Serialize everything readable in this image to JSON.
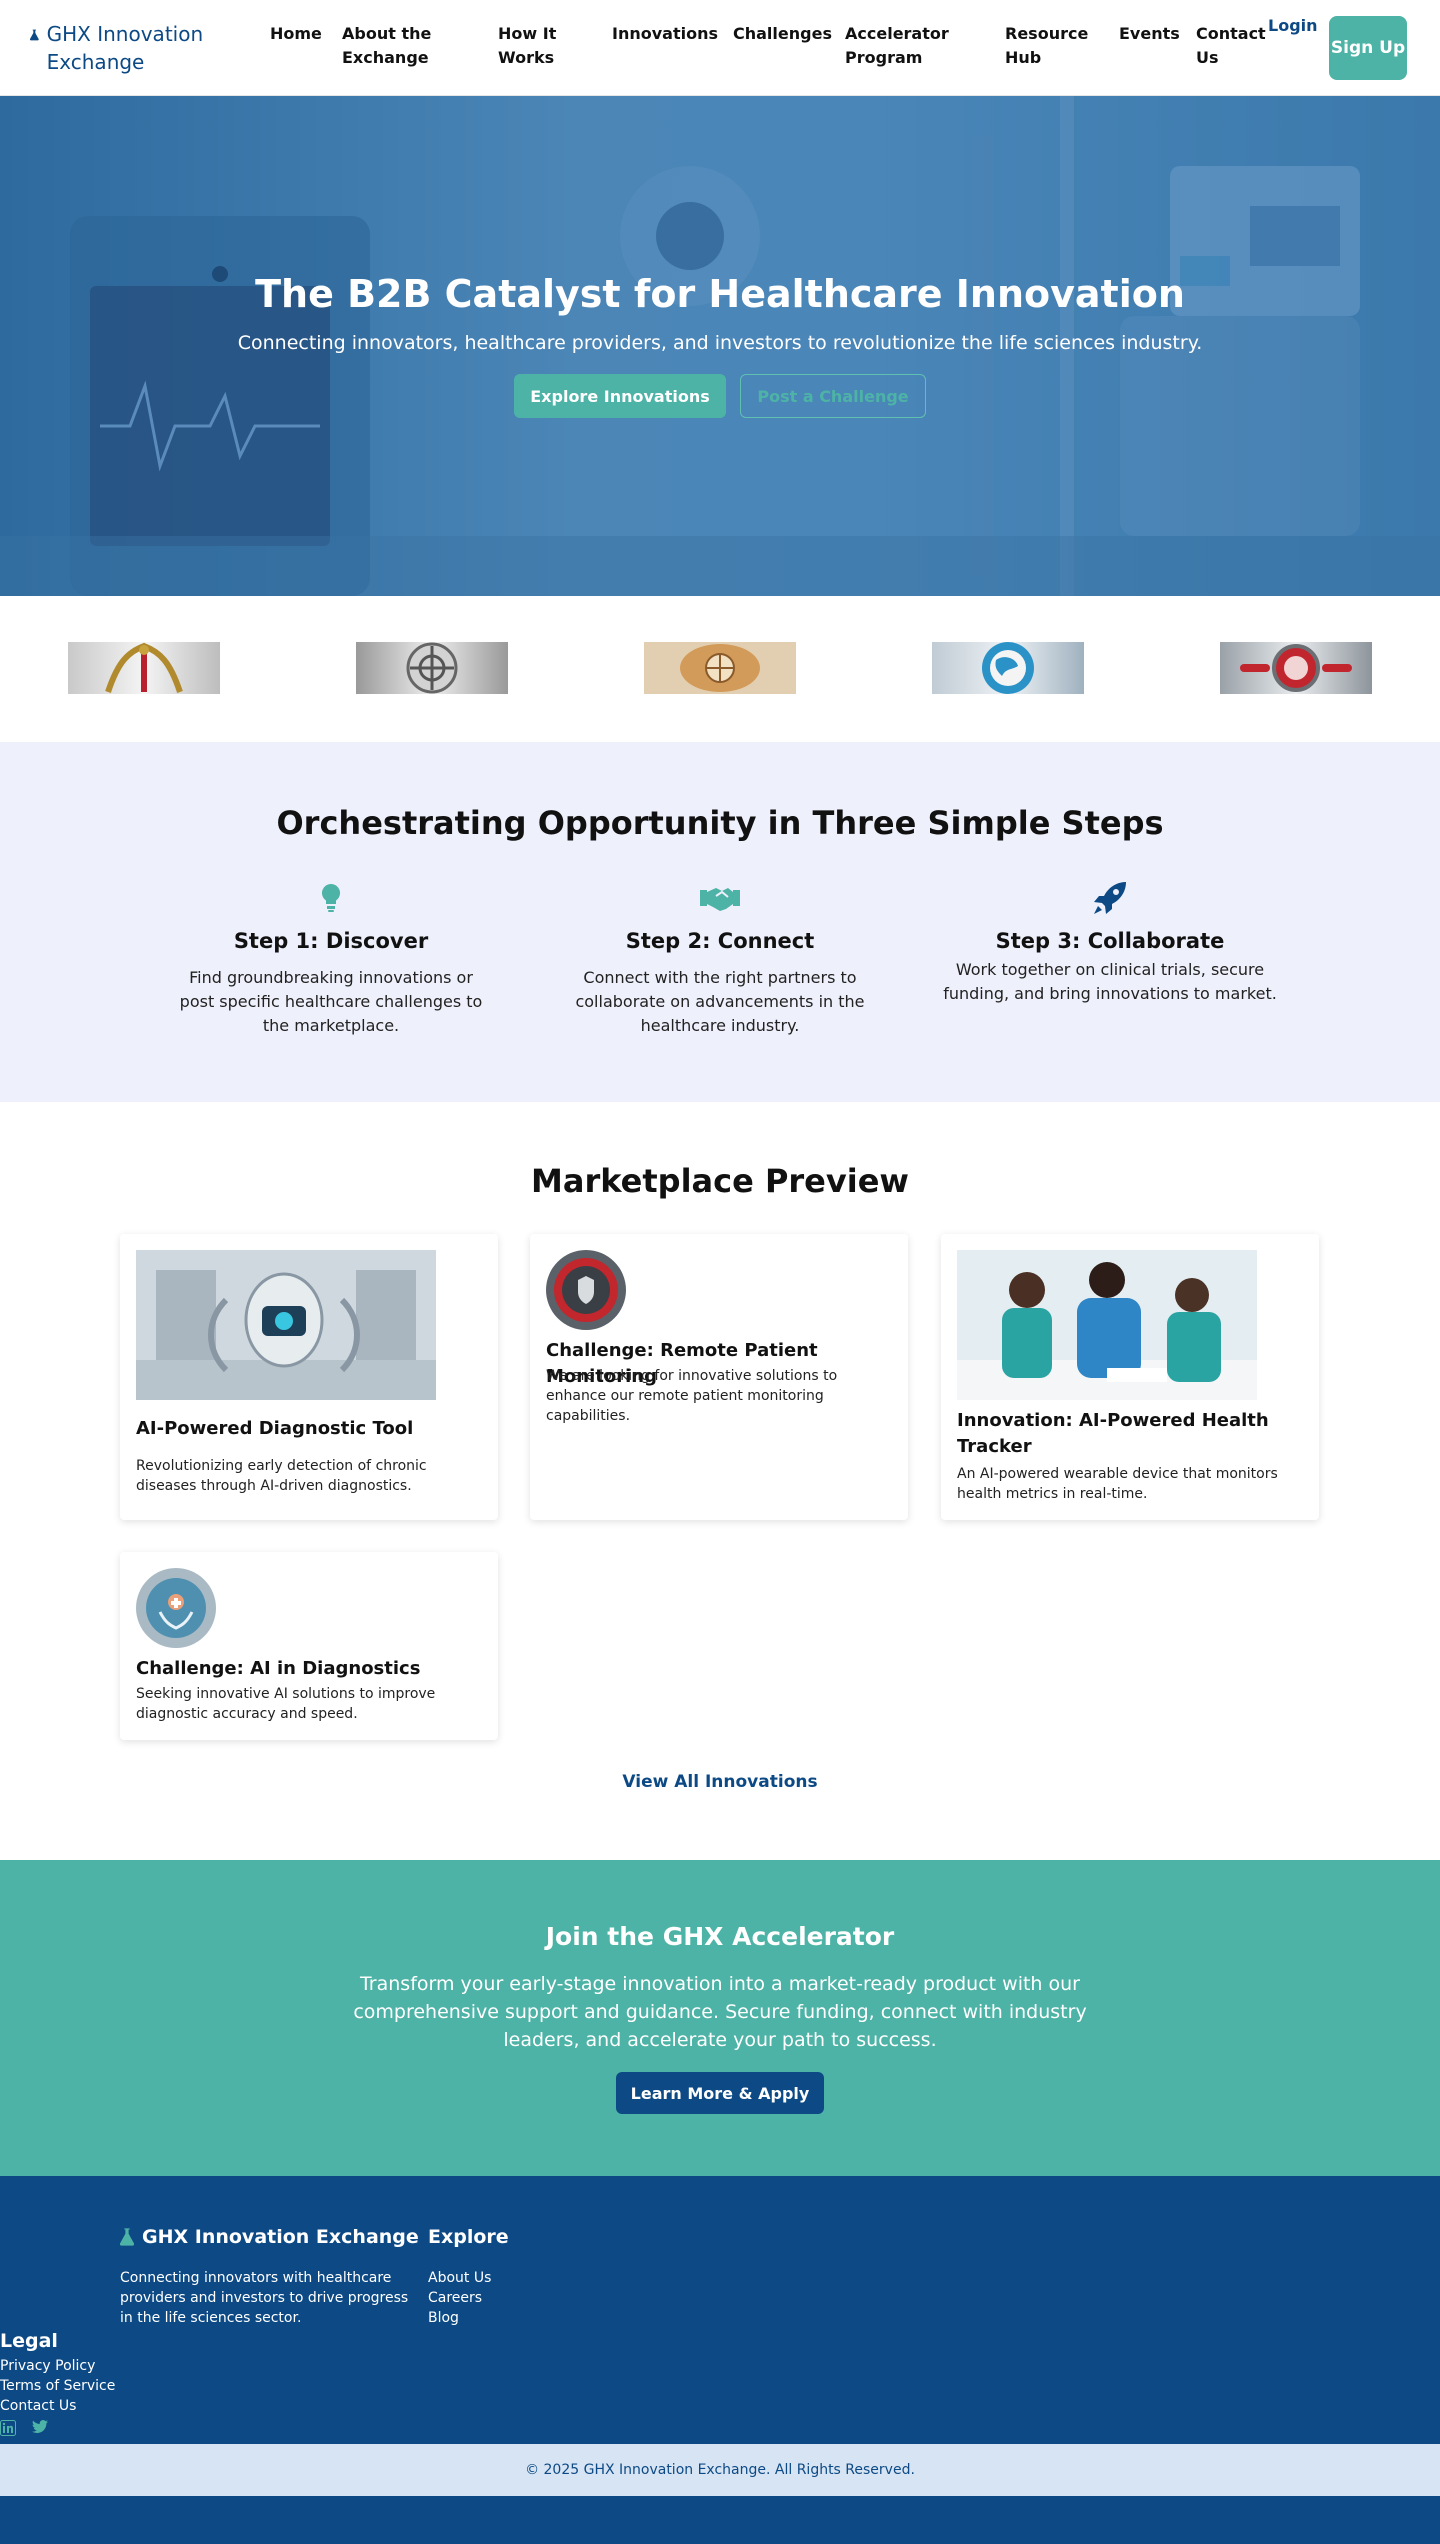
{
  "brand": {
    "name": "GHX Innovation Exchange",
    "icon": "flask-icon"
  },
  "nav": {
    "links": [
      "Home",
      "About the Exchange",
      "How It Works",
      "Innovations",
      "Challenges",
      "Accelerator Program",
      "Resource Hub",
      "Events",
      "Contact Us"
    ],
    "login": "Login",
    "signup": "Sign Up"
  },
  "hero": {
    "title": "The B2B Catalyst for Healthcare Innovation",
    "subtitle": "Connecting innovators, healthcare providers, and investors to revolutionize the life sciences industry.",
    "primary_cta": "Explore Innovations",
    "secondary_cta": "Post a Challenge"
  },
  "partner_logos": [
    "caduceus-logo",
    "celtic-knot-logo",
    "ornate-emblem-logo",
    "globe-logo",
    "red-emblem-logo"
  ],
  "steps": {
    "title": "Orchestrating Opportunity in Three Simple Steps",
    "items": [
      {
        "icon": "lightbulb-icon",
        "title": "Step 1: Discover",
        "desc": "Find groundbreaking innovations or post specific healthcare challenges to the marketplace."
      },
      {
        "icon": "handshake-icon",
        "title": "Step 2: Connect",
        "desc": "Connect with the right partners to collaborate on advancements in the healthcare industry."
      },
      {
        "icon": "rocket-icon",
        "title": "Step 3: Collaborate",
        "desc": "Work together on clinical trials, secure funding, and bring innovations to market."
      }
    ]
  },
  "marketplace": {
    "title": "Marketplace Preview",
    "cards": [
      {
        "title": "AI-Powered Diagnostic Tool",
        "desc": "Revolutionizing early detection of chronic diseases through AI-driven diagnostics."
      },
      {
        "title": "Challenge: Remote Patient Monitoring",
        "desc": "We are looking for innovative solutions to enhance our remote patient monitoring capabilities."
      },
      {
        "title": "Innovation: AI-Powered Health Tracker",
        "desc": "An AI-powered wearable device that monitors health metrics in real-time."
      },
      {
        "title": "Challenge: AI in Diagnostics",
        "desc": "Seeking innovative AI solutions to improve diagnostic accuracy and speed."
      }
    ],
    "view_all": "View All Innovations"
  },
  "accelerator": {
    "title": "Join the GHX Accelerator",
    "desc": "Transform your early-stage innovation into a market-ready product with our comprehensive support and guidance. Secure funding, connect with industry leaders, and accelerate your path to success.",
    "cta": "Learn More & Apply"
  },
  "footer": {
    "brand": "GHX Innovation Exchange",
    "desc": "Connecting innovators with healthcare providers and investors to drive progress in the life sciences sector.",
    "explore": {
      "title": "Explore",
      "links": [
        "About Us",
        "Careers",
        "Blog"
      ]
    },
    "legal": {
      "title": "Legal",
      "links": [
        "Privacy Policy",
        "Terms of Service",
        "Contact Us"
      ]
    },
    "social": [
      "linkedin-icon",
      "twitter-icon"
    ],
    "copyright": "© 2025 GHX Innovation Exchange. All Rights Reserved."
  },
  "colors": {
    "primary": "#0d4a85",
    "accent": "#4db3a6",
    "steps_bg": "#eef0fb",
    "copyright_bg": "#d6e4f3"
  }
}
